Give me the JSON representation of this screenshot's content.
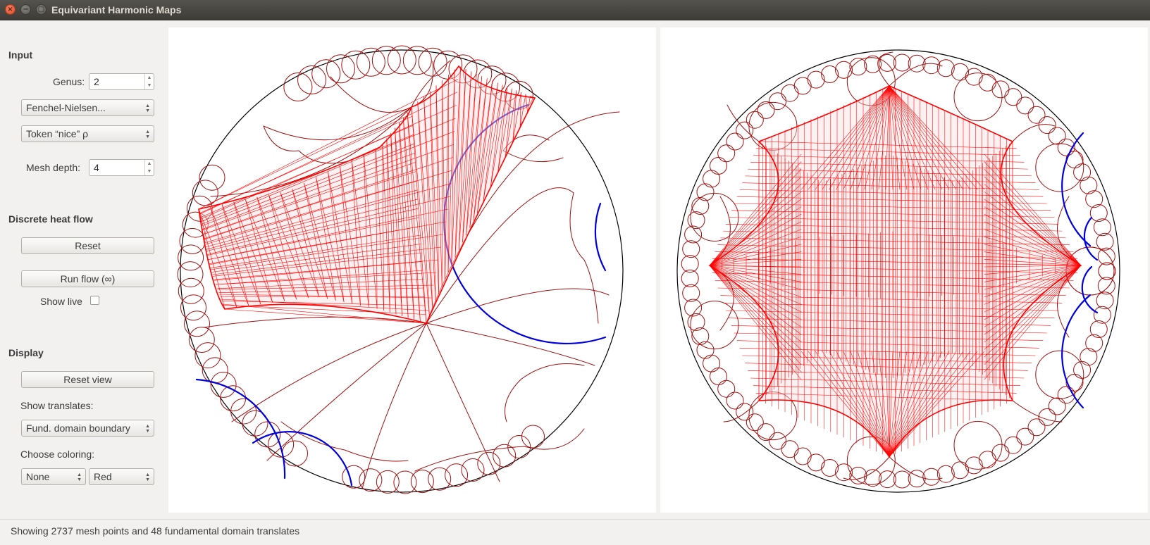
{
  "window": {
    "title": "Equivariant Harmonic Maps"
  },
  "input": {
    "heading": "Input",
    "genus_label": "Genus:",
    "genus_value": "2",
    "coords_combo": "Fenchel-Nielsen...",
    "rho_combo": "Token “nice” ρ",
    "mesh_depth_label": "Mesh depth:",
    "mesh_depth_value": "4"
  },
  "heat_flow": {
    "heading": "Discrete heat flow",
    "reset_label": "Reset",
    "run_label": "Run flow (∞)",
    "show_live_label": "Show live",
    "show_live_checked": false
  },
  "display": {
    "heading": "Display",
    "reset_view_label": "Reset view",
    "show_translates_label": "Show translates:",
    "translates_combo": "Fund. domain boundary",
    "coloring_label": "Choose coloring:",
    "coloring_left": "None",
    "coloring_right": "Red"
  },
  "status": {
    "text": "Showing 2737 mesh points and 48 fundamental domain translates"
  },
  "colors": {
    "mesh": "#ff0000",
    "translates": "#a01010",
    "geodesics": "#0000dd",
    "boundary": "#000000"
  }
}
